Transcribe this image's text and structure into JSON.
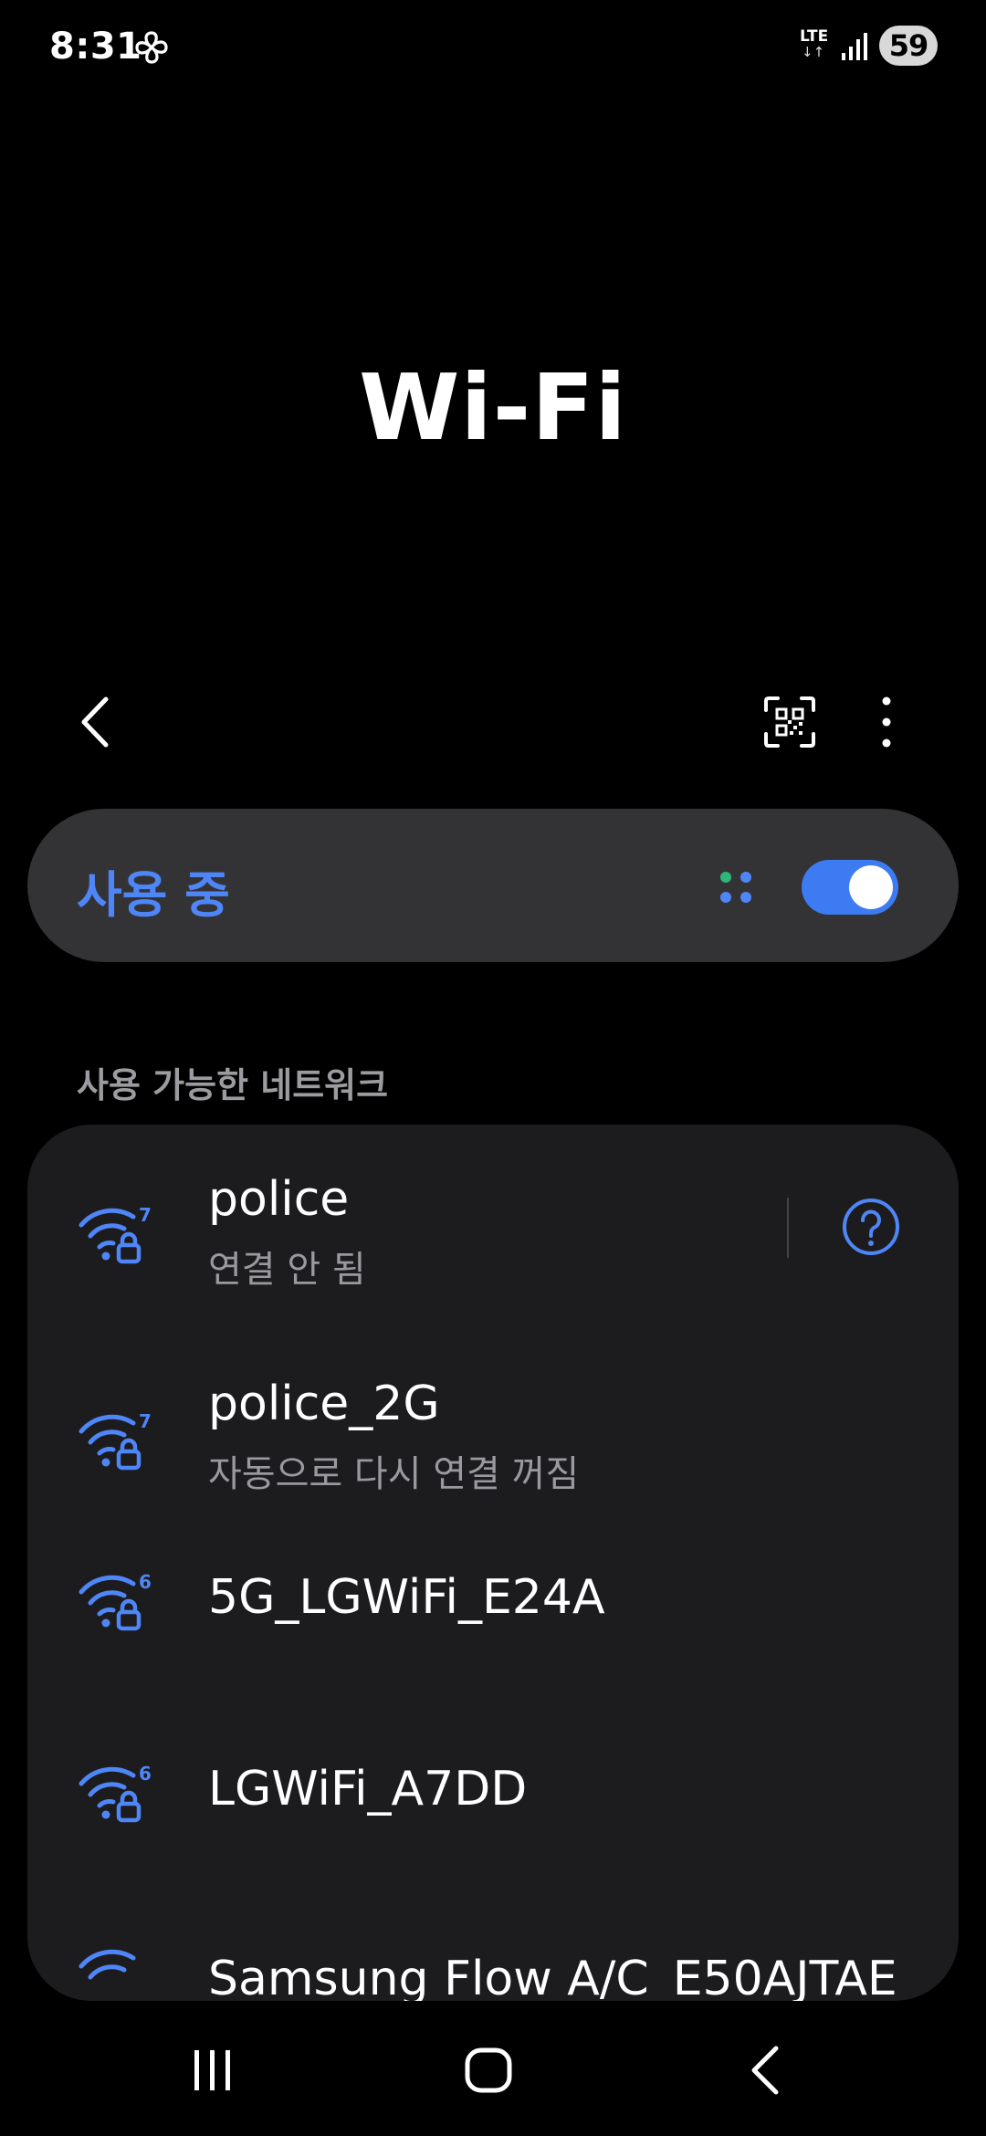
{
  "status_bar": {
    "time": "8:31",
    "network_type": "LTE",
    "network_arrows": "↓↑",
    "battery": "59"
  },
  "title": "Wi-Fi",
  "toolbar": {
    "back_icon": "chevron-left-icon",
    "qr_icon": "qr-scan-icon",
    "more_icon": "more-vertical-icon"
  },
  "wifi_toggle": {
    "label": "사용 중",
    "enabled": true,
    "accent_color": "#3d7bf2"
  },
  "available_networks": {
    "header": "사용 가능한 네트워크",
    "items": [
      {
        "name": "police",
        "status": "연결 안 됨",
        "wifi_standard": "7",
        "secured": true,
        "has_help": true
      },
      {
        "name": "police_2G",
        "status": "자동으로 다시 연결 꺼짐",
        "wifi_standard": "7",
        "secured": true,
        "has_help": false
      },
      {
        "name": "5G_LGWiFi_E24A",
        "status": "",
        "wifi_standard": "6",
        "secured": true,
        "has_help": false
      },
      {
        "name": "LGWiFi_A7DD",
        "status": "",
        "wifi_standard": "6",
        "secured": true,
        "has_help": false
      },
      {
        "name": "Samsung Flow A/C_E50AJTAE",
        "status": "",
        "wifi_standard": "",
        "secured": false,
        "has_help": false
      }
    ]
  },
  "nav_bar": {
    "recent_icon": "recent-apps-icon",
    "home_icon": "home-icon",
    "back_icon": "back-icon"
  }
}
